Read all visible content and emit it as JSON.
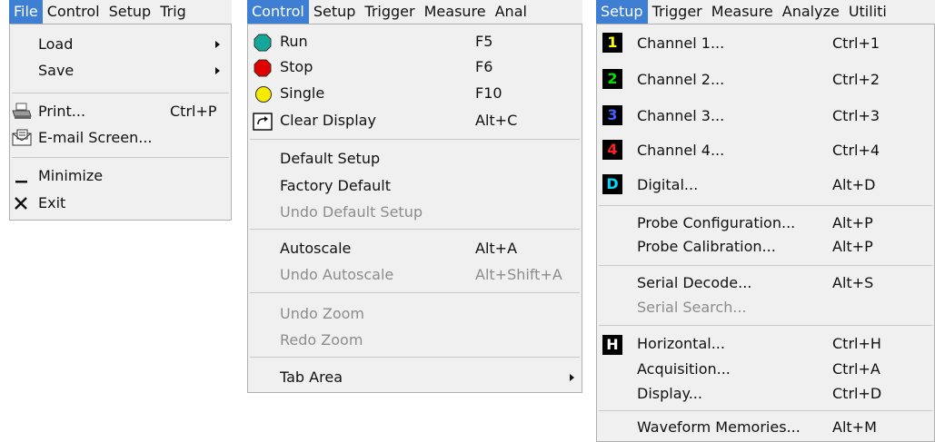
{
  "file_panel": {
    "menubar": [
      "File",
      "Control",
      "Setup",
      "Trig"
    ],
    "items": {
      "load": "Load",
      "save": "Save",
      "print": "Print...",
      "print_shortcut": "Ctrl+P",
      "email": "E-mail Screen...",
      "minimize": "Minimize",
      "exit": "Exit"
    }
  },
  "control_panel": {
    "menubar": [
      "Control",
      "Setup",
      "Trigger",
      "Measure",
      "Anal"
    ],
    "items": {
      "run": "Run",
      "run_shortcut": "F5",
      "stop": "Stop",
      "stop_shortcut": "F6",
      "single": "Single",
      "single_shortcut": "F10",
      "clear_display": "Clear Display",
      "clear_display_shortcut": "Alt+C",
      "default_setup": "Default Setup",
      "factory_default": "Factory Default",
      "undo_default_setup": "Undo Default Setup",
      "autoscale": "Autoscale",
      "autoscale_shortcut": "Alt+A",
      "undo_autoscale": "Undo Autoscale",
      "undo_autoscale_shortcut": "Alt+Shift+A",
      "undo_zoom": "Undo Zoom",
      "redo_zoom": "Redo Zoom",
      "tab_area": "Tab Area"
    }
  },
  "setup_panel": {
    "menubar": [
      "Setup",
      "Trigger",
      "Measure",
      "Analyze",
      "Utiliti"
    ],
    "items": {
      "ch1_badge": "1",
      "ch1": "Channel 1...",
      "ch1_shortcut": "Ctrl+1",
      "ch2_badge": "2",
      "ch2": "Channel 2...",
      "ch2_shortcut": "Ctrl+2",
      "ch3_badge": "3",
      "ch3": "Channel 3...",
      "ch3_shortcut": "Ctrl+3",
      "ch4_badge": "4",
      "ch4": "Channel 4...",
      "ch4_shortcut": "Ctrl+4",
      "digital_badge": "D",
      "digital": "Digital...",
      "digital_shortcut": "Alt+D",
      "probe_config": "Probe Configuration...",
      "probe_config_shortcut": "Alt+P",
      "probe_cal": "Probe Calibration...",
      "probe_cal_shortcut": "Alt+P",
      "serial_decode": "Serial Decode...",
      "serial_decode_shortcut": "Alt+S",
      "serial_search": "Serial Search...",
      "horizontal_badge": "H",
      "horizontal": "Horizontal...",
      "horizontal_shortcut": "Ctrl+H",
      "acquisition": "Acquisition...",
      "acquisition_shortcut": "Ctrl+A",
      "display": "Display...",
      "display_shortcut": "Ctrl+D",
      "waveform_memories": "Waveform Memories...",
      "waveform_memories_shortcut": "Alt+M"
    }
  },
  "colors": {
    "menu_highlight": "#3f7fd3",
    "menu_background": "#f0f0f0",
    "disabled_text": "#8c8c8c",
    "run": "#17a79a",
    "stop": "#e00000",
    "single": "#f5ea00",
    "ch1": "#ffff00",
    "ch2": "#00e000",
    "ch3": "#4060ff",
    "ch4": "#ff2020",
    "digital": "#00d8ff"
  }
}
